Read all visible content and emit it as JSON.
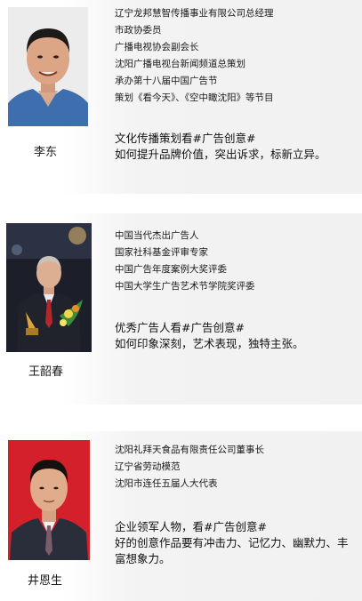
{
  "people": [
    {
      "name": "李东",
      "bio": [
        "辽宁龙邦慧智传播事业有限公司总经理",
        "市政协委员",
        "广播电视协会副会长",
        "沈阳广播电视台新闻频道总策划",
        "承办第十八届中国广告节",
        "策划《看今天》、《空中瞰沈阳》等节目"
      ],
      "headline": "文化传播策划看#广告创意#",
      "quote": "如何提升品牌价值，突出诉求，标新立异。"
    },
    {
      "name": "王韶春",
      "bio": [
        "中国当代杰出广告人",
        "国家社科基金评审专家",
        "中国广告年度案例大奖评委",
        "中国大学生广告艺术节学院奖评委"
      ],
      "headline": "优秀广告人看#广告创意#",
      "quote": "如何印象深刻，艺术表现，独特主张。"
    },
    {
      "name": "井恩生",
      "bio": [
        "沈阳礼拜天食品有限责任公司董事长",
        "辽宁省劳动模范",
        "沈阳市连任五届人大代表"
      ],
      "headline": "企业领军人物，看#广告创意#",
      "quote": "好的创意作品要有冲击力、记忆力、幽默力、丰富想象力。"
    }
  ]
}
